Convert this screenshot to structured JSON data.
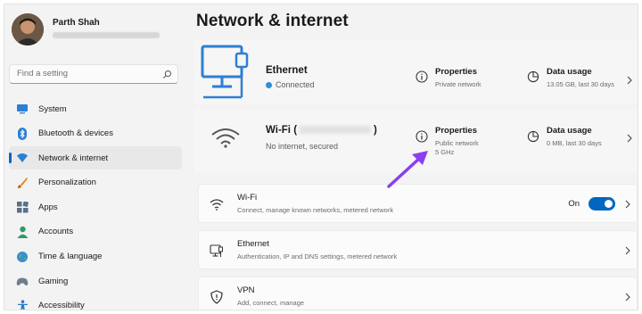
{
  "profile": {
    "name": "Parth Shah"
  },
  "search": {
    "placeholder": "Find a setting"
  },
  "sidebar": {
    "items": [
      {
        "label": "System",
        "icon": "monitor-icon"
      },
      {
        "label": "Bluetooth & devices",
        "icon": "bluetooth-icon"
      },
      {
        "label": "Network & internet",
        "icon": "wifi-icon",
        "active": true
      },
      {
        "label": "Personalization",
        "icon": "brush-icon"
      },
      {
        "label": "Apps",
        "icon": "apps-icon"
      },
      {
        "label": "Accounts",
        "icon": "person-icon"
      },
      {
        "label": "Time & language",
        "icon": "globe-icon"
      },
      {
        "label": "Gaming",
        "icon": "controller-icon"
      },
      {
        "label": "Accessibility",
        "icon": "accessibility-icon"
      }
    ]
  },
  "main": {
    "title": "Network & internet",
    "ethernet_card": {
      "name": "Ethernet",
      "status": "Connected",
      "properties_title": "Properties",
      "properties_sub": "Private network",
      "usage_title": "Data usage",
      "usage_sub": "13.05 GB, last 30 days"
    },
    "wifi_card": {
      "name": "Wi-Fi (",
      "name_tail": ")",
      "status": "No internet, secured",
      "properties_title": "Properties",
      "properties_sub": "Public network",
      "properties_sub2": "5 GHz",
      "usage_title": "Data usage",
      "usage_sub": "0 MB, last 30 days"
    },
    "rows": [
      {
        "title": "Wi-Fi",
        "sub": "Connect, manage known networks, metered network",
        "toggle_label": "On",
        "toggle_on": true
      },
      {
        "title": "Ethernet",
        "sub": "Authentication, IP and DNS settings, metered network"
      },
      {
        "title": "VPN",
        "sub": "Add, connect, manage"
      }
    ]
  },
  "colors": {
    "accent": "#0067c0",
    "annotation_arrow": "#8a3ff0",
    "connected_dot": "#2e8fd6"
  }
}
